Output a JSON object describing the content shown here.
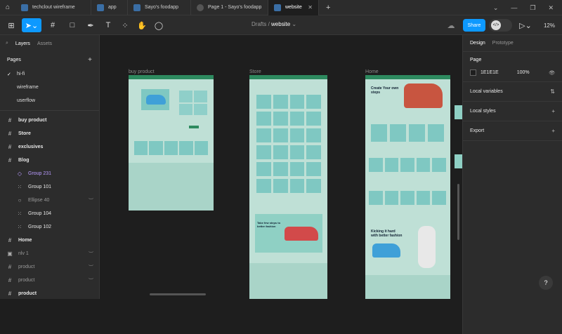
{
  "tabs": [
    {
      "label": "techclout wireframe",
      "active": false
    },
    {
      "label": "app",
      "active": false
    },
    {
      "label": "Sayo's foodapp",
      "active": false
    },
    {
      "label": "Page 1 - Sayo's foodapp",
      "active": false
    },
    {
      "label": "website",
      "active": true
    }
  ],
  "toolbar": {
    "crumb_root": "Drafts",
    "crumb_file": "website",
    "share": "Share",
    "zoom": "12%"
  },
  "left_panel": {
    "tab_layers": "Layers",
    "tab_assets": "Assets",
    "page_filter": "hi-fi",
    "pages_heading": "Pages",
    "pages": [
      "hi-fi",
      "wireframe",
      "userflow"
    ],
    "layers": [
      {
        "label": "buy product",
        "kind": "frame",
        "indent": false,
        "style": "bold"
      },
      {
        "label": "Store",
        "kind": "frame",
        "indent": false,
        "style": "bold"
      },
      {
        "label": "exclusives",
        "kind": "frame",
        "indent": false,
        "style": "bold"
      },
      {
        "label": "Blog",
        "kind": "frame",
        "indent": false,
        "style": "bold"
      },
      {
        "label": "Group 231",
        "kind": "component",
        "indent": true,
        "style": "comp"
      },
      {
        "label": "Group 101",
        "kind": "group",
        "indent": true,
        "style": ""
      },
      {
        "label": "Ellipse 40",
        "kind": "ellipse",
        "indent": true,
        "style": "dim"
      },
      {
        "label": "Group 104",
        "kind": "group",
        "indent": true,
        "style": ""
      },
      {
        "label": "Group 102",
        "kind": "group",
        "indent": true,
        "style": ""
      },
      {
        "label": "Home",
        "kind": "frame",
        "indent": false,
        "style": "bold"
      },
      {
        "label": "nlv 1",
        "kind": "image",
        "indent": false,
        "style": "dim"
      },
      {
        "label": "product",
        "kind": "frame",
        "indent": false,
        "style": "dim"
      },
      {
        "label": "product",
        "kind": "frame",
        "indent": false,
        "style": "dim"
      },
      {
        "label": "product",
        "kind": "frame",
        "indent": false,
        "style": "bold"
      }
    ]
  },
  "canvas": {
    "frames": [
      {
        "label": "buy product"
      },
      {
        "label": "Store"
      },
      {
        "label": "Home"
      }
    ],
    "store_banner": "Take few steps to better fashion",
    "home_hero": "Create Your own steps",
    "home_promo": "Kicking it hard with better fashion"
  },
  "right_panel": {
    "tab_design": "Design",
    "tab_prototype": "Prototype",
    "page_heading": "Page",
    "bg_hex": "1E1E1E",
    "bg_opacity": "100%",
    "rows": [
      "Local variables",
      "Local styles",
      "Export"
    ]
  },
  "colors": {
    "accent": "#0d99ff",
    "frame_bg": "#bfe0d6",
    "frame_header": "#2d8a5f",
    "component": "#b99bff"
  }
}
